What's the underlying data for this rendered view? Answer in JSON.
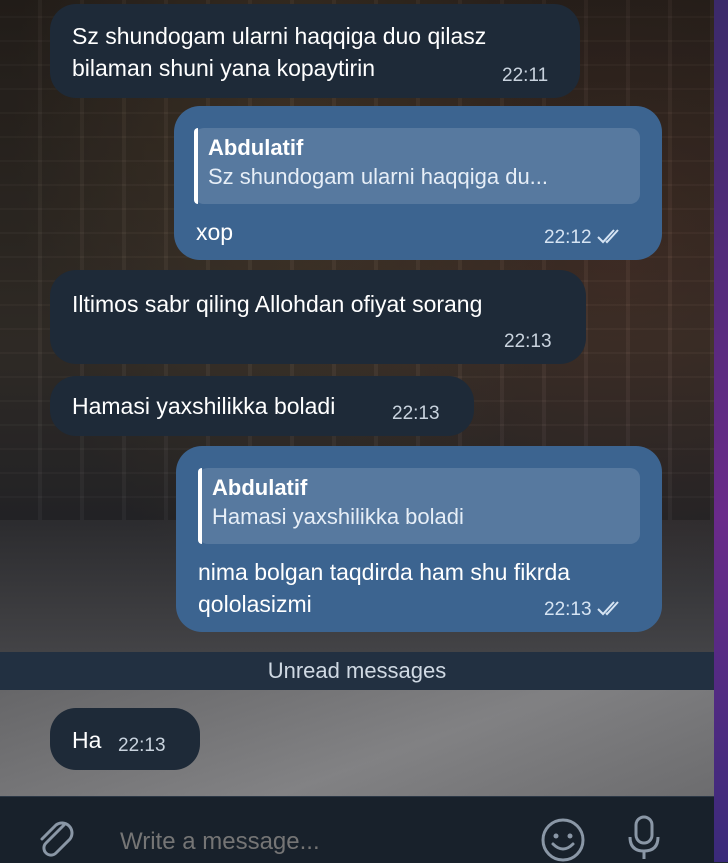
{
  "messages": [
    {
      "direction": "incoming",
      "text_line1": "Sz shundogam ularni haqqiga duo qilasz",
      "text_line2": "bilaman shuni yana kopaytirin",
      "time": "22:11"
    },
    {
      "direction": "outgoing",
      "reply_name": "Abdulatif",
      "reply_text": "Sz shundogam ularni haqqiga du...",
      "text": "xop",
      "time": "22:12",
      "read_icon": "double-check-icon"
    },
    {
      "direction": "incoming",
      "text": "Iltimos sabr qiling Allohdan ofiyat sorang",
      "time": "22:13"
    },
    {
      "direction": "incoming",
      "text": "Hamasi yaxshilikka boladi",
      "time": "22:13"
    },
    {
      "direction": "outgoing",
      "reply_name": "Abdulatif",
      "reply_text": "Hamasi yaxshilikka boladi",
      "text_line1": "nima bolgan taqdirda ham shu fikrda",
      "text_line2": "qololasizmi",
      "time": "22:13",
      "read_icon": "double-check-icon"
    },
    {
      "direction": "incoming",
      "text": "Ha",
      "time": "22:13"
    }
  ],
  "divider": {
    "label": "Unread messages"
  },
  "composer": {
    "placeholder": "Write a message...",
    "attach_icon": "paperclip-icon",
    "emoji_icon": "emoji-icon",
    "mic_icon": "microphone-icon"
  },
  "colors": {
    "incoming_bubble": "#1e2a38",
    "outgoing_bubble": "#3c6490",
    "composer_bg": "#18212b"
  }
}
